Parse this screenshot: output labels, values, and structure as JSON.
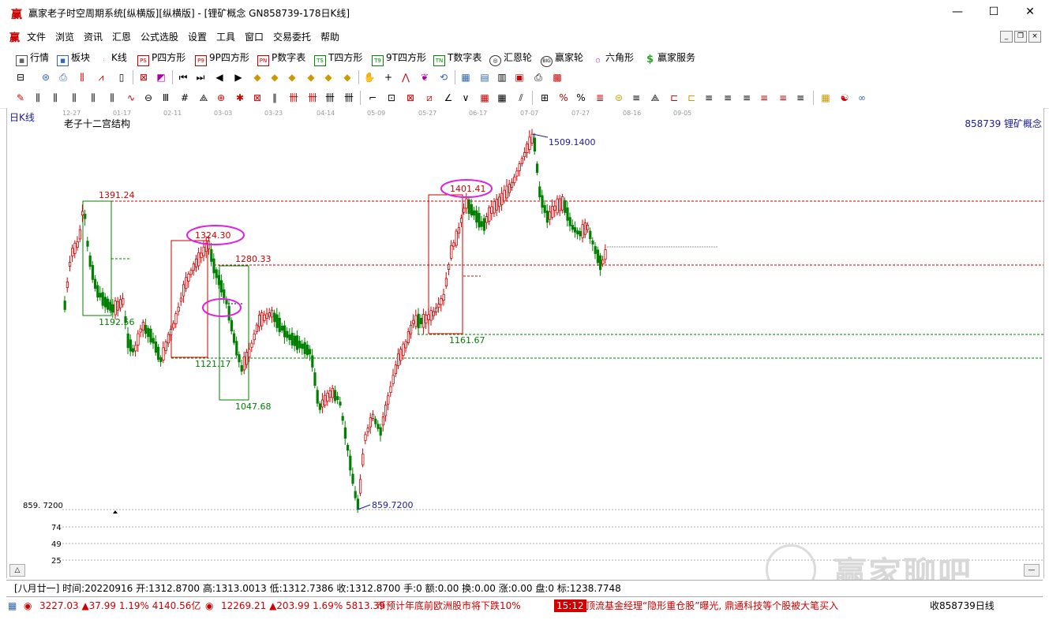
{
  "window": {
    "title": "赢家老子时空周期系统[纵横版][纵横版] - [锂矿概念  GN858739-178日K线]",
    "min": "—",
    "max": "☐",
    "close": "✕"
  },
  "menu": {
    "logo": "赢",
    "items": [
      "文件",
      "浏览",
      "资讯",
      "汇恩",
      "公式选股",
      "设置",
      "工具",
      "窗口",
      "交易委托",
      "帮助"
    ]
  },
  "toolbar1": {
    "items": [
      {
        "label": "行情",
        "icon": "grid-icon"
      },
      {
        "label": "板块",
        "icon": "blocks-icon"
      },
      {
        "label": "K线",
        "icon": "kline-icon"
      },
      {
        "label": "P四方形",
        "icon": "ps-icon"
      },
      {
        "label": "9P四方形",
        "icon": "p9-icon"
      },
      {
        "label": "P数字表",
        "icon": "pn-icon"
      },
      {
        "label": "T四方形",
        "icon": "ts-icon"
      },
      {
        "label": "9T四方形",
        "icon": "t9-icon"
      },
      {
        "label": "T数字表",
        "icon": "tn-icon"
      },
      {
        "label": "汇恩轮",
        "icon": "wheel-icon"
      },
      {
        "label": "赢家轮",
        "icon": "big-wheel-icon"
      },
      {
        "label": "六角形",
        "icon": "hexagon-icon"
      },
      {
        "label": "赢家服务",
        "icon": "dollar-icon"
      }
    ]
  },
  "chart": {
    "period_label": "日K线",
    "indicator_label": "老子十二宫结构",
    "symbol_label": "858739  锂矿概念",
    "date_ticks": [
      "12-27",
      "01-17",
      "02-11",
      "03-03",
      "03-23",
      "04-14",
      "05-09",
      "05-27",
      "06-17",
      "07-07",
      "07-27",
      "08-16",
      "09-05"
    ],
    "price_labels": {
      "p1391": "1391.24",
      "p1324": "1324.30",
      "p1280": "1280.33",
      "p1192": "1192.56",
      "p1121": "1121.17",
      "p1047": "1047.68",
      "p1401": "1401.41",
      "p1161": "1161.67",
      "p1509": "1509.1400",
      "p859": "859.7200",
      "left_low": "859. 7200"
    },
    "lower_axis": [
      "74",
      "49",
      "25"
    ]
  },
  "status": {
    "text": "[八月廿一] 时间:20220916 开:1312.8700 高:1313.0013 低:1312.7386 收:1312.8700 手:0 额:0.00 换:0.00 涨:0.00 盘:0 标:1238.7748"
  },
  "ticker": {
    "sh": "3227.03 ▲37.99 1.19% 4140.56亿",
    "sz": "12269.21 ▲203.99 1.69% 5813.39",
    "news1": "币预计年底前欧洲股市将下跌10%",
    "time": "15:12",
    "news2": "顶流基金经理“隐形重仓股”曝光, 鼎通科技等个股被大笔买入",
    "right": "收858739日线"
  },
  "watermark": "赢家聊吧",
  "colors": {
    "up": "#d00000",
    "down": "#008000",
    "blue": "#1a1a9c",
    "magenta": "#e020e0"
  }
}
